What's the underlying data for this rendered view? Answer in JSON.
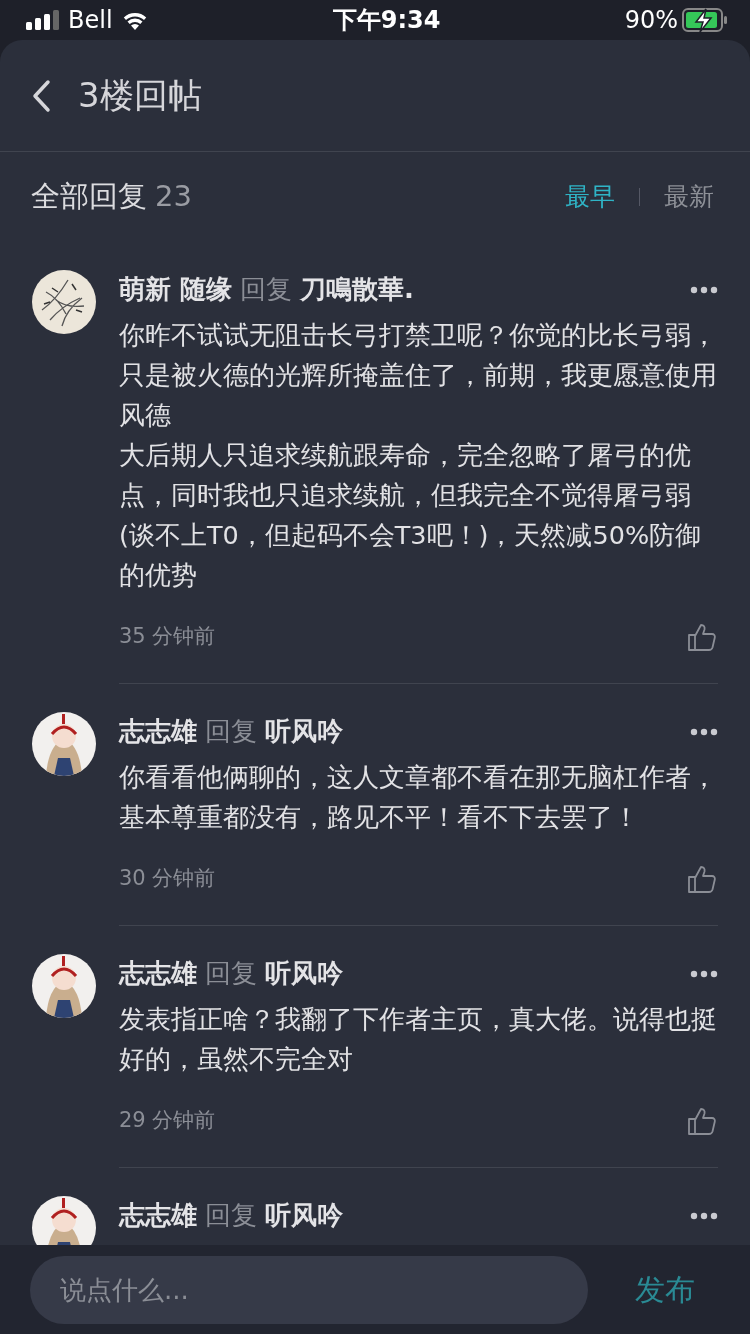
{
  "status_bar": {
    "carrier": "Bell",
    "time": "下午9:34",
    "battery": "90%"
  },
  "header": {
    "title": "3楼回帖"
  },
  "replies_header": {
    "label": "全部回复",
    "count": "23"
  },
  "sort_tabs": [
    {
      "label": "最早",
      "selected": true
    },
    {
      "label": "最新",
      "selected": false
    }
  ],
  "comments": [
    {
      "author": "萌新 随缘",
      "reply_word": "回复",
      "reply_to": "刀鳴散華.",
      "paragraphs": [
        "你昨不试试无阻击长弓打禁卫呢？你觉的比长弓弱，只是被火德的光辉所掩盖住了，前期，我更愿意使用风德",
        "大后期人只追求续航跟寿命，完全忽略了屠弓的优点，同时我也只追求续航，但我完全不觉得屠弓弱 (谈不上T0，但起码不会T3吧！)，天然减50%防御的优势"
      ],
      "time": "35 分钟前"
    },
    {
      "author": "志志雄",
      "reply_word": "回复",
      "reply_to": "听风吟",
      "paragraphs": [
        "你看看他俩聊的，这人文章都不看在那无脑杠作者，基本尊重都没有，路见不平！看不下去罢了！"
      ],
      "time": "30 分钟前"
    },
    {
      "author": "志志雄",
      "reply_word": "回复",
      "reply_to": "听风吟",
      "paragraphs": [
        "发表指正啥？我翻了下作者主页，真大佬。说得也挺好的，虽然不完全对"
      ],
      "time": "29 分钟前"
    },
    {
      "author": "志志雄",
      "reply_word": "回复",
      "reply_to": "听风吟"
    }
  ],
  "composer": {
    "placeholder": "说点什么...",
    "submit": "发布"
  }
}
